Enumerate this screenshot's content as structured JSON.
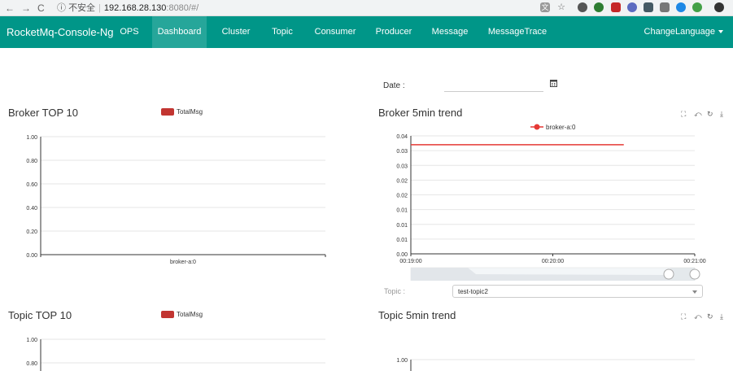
{
  "browser": {
    "back": "←",
    "forward": "→",
    "reload": "C",
    "insecure_label": "不安全",
    "host": "192.168.28.130",
    "path": ":8080/#/"
  },
  "navbar": {
    "brand": "RocketMq-Console-Ng",
    "items": [
      {
        "label": "OPS"
      },
      {
        "label": "Dashboard"
      },
      {
        "label": "Cluster"
      },
      {
        "label": "Topic"
      },
      {
        "label": "Consumer"
      },
      {
        "label": "Producer"
      },
      {
        "label": "Message"
      },
      {
        "label": "MessageTrace"
      }
    ],
    "active": "Dashboard",
    "language": "ChangeLanguage"
  },
  "date": {
    "label": "Date :"
  },
  "topic_select": {
    "label": "Topic :",
    "value": "test-topic2"
  },
  "chart_data": [
    {
      "type": "bar",
      "title": "Broker TOP 10",
      "legend": [
        "TotalMsg"
      ],
      "categories": [
        "broker-a:0"
      ],
      "series": [
        {
          "name": "TotalMsg",
          "values": [
            0
          ]
        }
      ],
      "ylim": [
        0,
        1
      ],
      "yticks": [
        "0.00",
        "0.20",
        "0.40",
        "0.60",
        "0.80",
        "1.00"
      ],
      "color": "#c23531"
    },
    {
      "type": "line",
      "title": "Broker 5min trend",
      "legend": [
        "broker-a:0"
      ],
      "x": [
        "00:19:00",
        "00:20:00",
        "00:21:00"
      ],
      "series": [
        {
          "name": "broker-a:0",
          "values": [
            0.037,
            0.037
          ]
        }
      ],
      "ylim": [
        0,
        0.04
      ],
      "yticks": [
        "0.00",
        "0.01",
        "0.01",
        "0.01",
        "0.02",
        "0.02",
        "0.03",
        "0.03",
        "0.04"
      ],
      "color": "#e53935"
    },
    {
      "type": "bar",
      "title": "Topic TOP 10",
      "legend": [
        "TotalMsg"
      ],
      "yticks": [
        "0.80",
        "1.00"
      ],
      "ylim": [
        0,
        1
      ],
      "color": "#c23531"
    },
    {
      "type": "line",
      "title": "Topic 5min trend",
      "yticks": [
        "1.00"
      ],
      "ylim": [
        0,
        1
      ]
    }
  ]
}
